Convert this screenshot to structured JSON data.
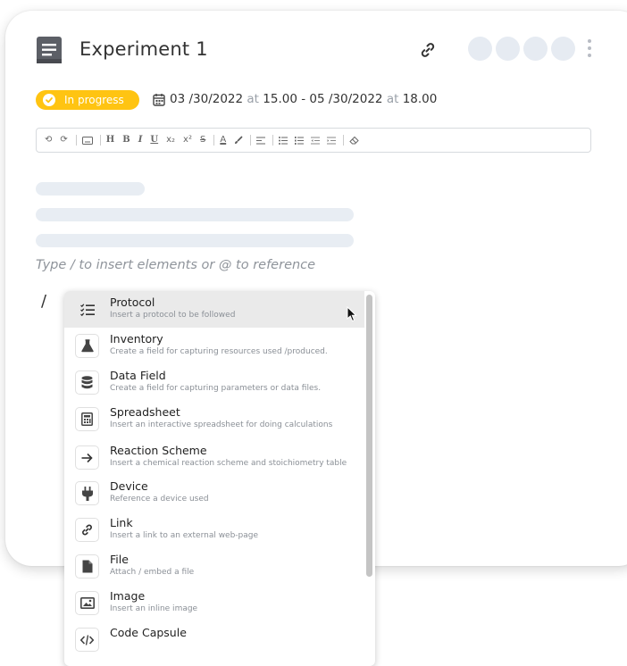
{
  "document": {
    "title": "Experiment 1",
    "avatars_count": 4
  },
  "status": {
    "label": "In progress",
    "color": "#ffc412"
  },
  "schedule": {
    "start_date": "03 /30/2022",
    "start_at": "at",
    "start_time": "15.00",
    "separator": "-",
    "end_date": "05 /30/2022",
    "end_at": "at",
    "end_time": "18.00"
  },
  "toolbar": {
    "undo": "⟲",
    "redo": "⟳",
    "heading": "H",
    "bold": "B",
    "italic": "I",
    "underline": "U",
    "subscript": "x₂",
    "superscript": "x²",
    "strikethrough": "S",
    "text_color": "A"
  },
  "editor": {
    "placeholder": "Type / to insert elements or @ to reference",
    "slash": "/"
  },
  "insert_menu": {
    "items": [
      {
        "title": "Protocol",
        "desc": "Insert a protocol to be followed",
        "icon": "checklist-icon"
      },
      {
        "title": "Inventory",
        "desc": "Create a field for capturing resources used /produced.",
        "icon": "flask-icon"
      },
      {
        "title": "Data Field",
        "desc": "Create a field for capturing parameters or data files.",
        "icon": "database-icon"
      },
      {
        "title": "Spreadsheet",
        "desc": "Insert an interactive spreadsheet for doing calculations",
        "icon": "calculator-icon"
      },
      {
        "title": "Reaction Scheme",
        "desc": "Insert a chemical reaction scheme and stoichiometry table",
        "icon": "arrow-right-icon"
      },
      {
        "title": "Device",
        "desc": "Reference a device used",
        "icon": "plug-icon"
      },
      {
        "title": "Link",
        "desc": "Insert a link to an external web-page",
        "icon": "link-icon"
      },
      {
        "title": "File",
        "desc": "Attach / embed a file",
        "icon": "file-icon"
      },
      {
        "title": "Image",
        "desc": "Insert an inline image",
        "icon": "image-icon"
      },
      {
        "title": "Code Capsule",
        "desc": "",
        "icon": "code-icon"
      }
    ]
  }
}
